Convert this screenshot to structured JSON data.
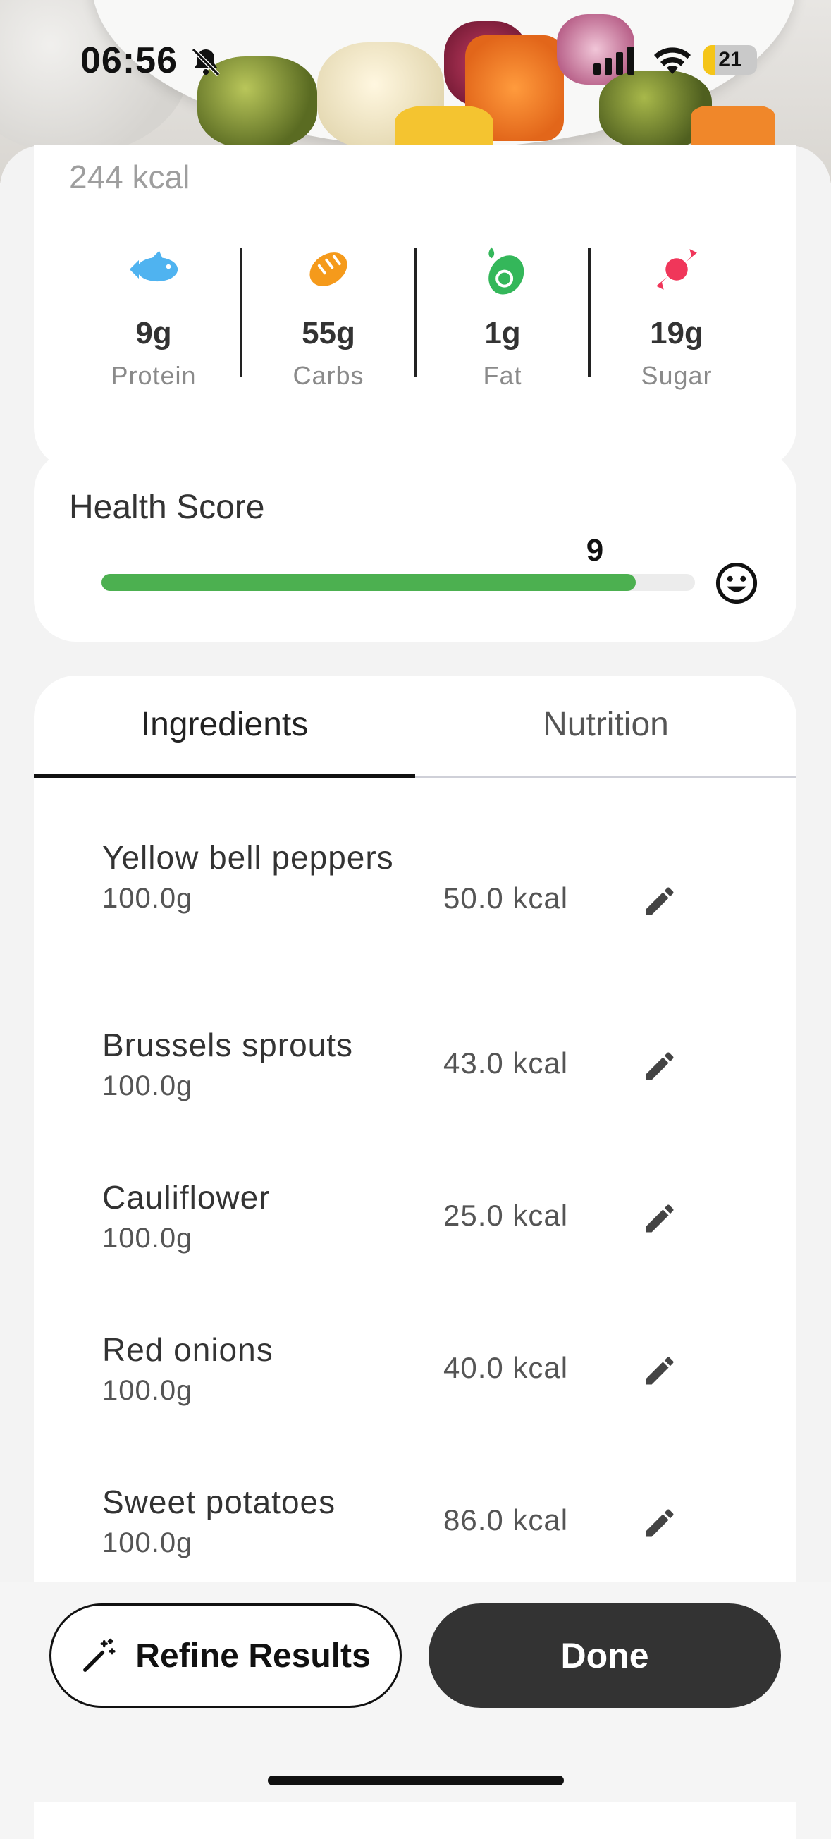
{
  "status_bar": {
    "time": "06:56",
    "battery": "21"
  },
  "summary": {
    "calories": "244 kcal",
    "macros": [
      {
        "value": "9g",
        "label": "Protein",
        "icon": "fish-icon",
        "color": "#4fb3f0"
      },
      {
        "value": "55g",
        "label": "Carbs",
        "icon": "bread-icon",
        "color": "#f59a1b"
      },
      {
        "value": "1g",
        "label": "Fat",
        "icon": "avocado-icon",
        "color": "#34b75a"
      },
      {
        "value": "19g",
        "label": "Sugar",
        "icon": "candy-icon",
        "color": "#f0365a"
      }
    ]
  },
  "health": {
    "title": "Health Score",
    "score": "9",
    "max": 10,
    "fraction": 0.9,
    "bar_color": "#4cb050"
  },
  "tabs": {
    "ingredients": "Ingredients",
    "nutrition": "Nutrition",
    "active": "Ingredients"
  },
  "ingredients": [
    {
      "name": "Yellow bell peppers",
      "qty": "100.0g",
      "kcal": "50.0 kcal"
    },
    {
      "name": "Brussels sprouts",
      "qty": "100.0g",
      "kcal": "43.0 kcal"
    },
    {
      "name": "Cauliflower",
      "qty": "100.0g",
      "kcal": "25.0 kcal"
    },
    {
      "name": "Red onions",
      "qty": "100.0g",
      "kcal": "40.0 kcal"
    },
    {
      "name": "Sweet potatoes",
      "qty": "100.0g",
      "kcal": "86.0 kcal"
    }
  ],
  "actions": {
    "refine": "Refine Results",
    "done": "Done"
  }
}
